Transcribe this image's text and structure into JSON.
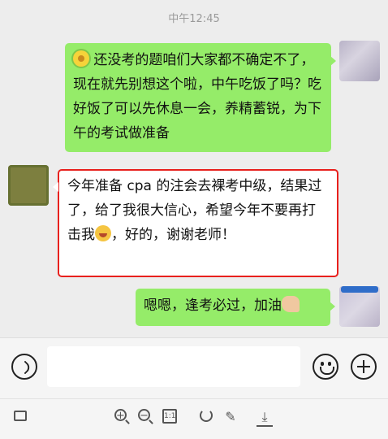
{
  "chat": {
    "timestamp": "中午12:45",
    "messages": [
      {
        "sender": "me",
        "emoji_prefix": "flower-emoji",
        "text": "还没考的题咱们大家都不确定不了，现在就先别想这个啦，中午吃饭了吗？吃好饭了可以先休息一会，养精蓄锐，为下午的考试做准备"
      },
      {
        "sender": "other",
        "text_before": "今年准备 cpa 的注会去裸考中级，结果过了，给了我很大信心，希望今年不要再打击我",
        "emoji": "laugh-cry-emoji",
        "text_after": "，好的，谢谢老师！",
        "highlight_color": "#e8201d"
      },
      {
        "sender": "me",
        "text": "嗯嗯，逢考必过，加油",
        "emoji_suffix": "flexed-arm-emoji"
      }
    ]
  },
  "input_bar": {
    "text_value": "",
    "icons": [
      "voice-icon",
      "emoji-icon",
      "plus-icon"
    ]
  },
  "toolbar": {
    "actual_size_label": "1:1",
    "icons": [
      "layout-icon",
      "zoom-in-icon",
      "zoom-out-icon",
      "actual-size-icon",
      "rotate-icon",
      "edit-icon",
      "download-icon"
    ]
  },
  "colors": {
    "background": "#ededed",
    "my_bubble": "#95ec69",
    "other_bubble": "#ffffff",
    "highlight_border": "#e8201d"
  }
}
